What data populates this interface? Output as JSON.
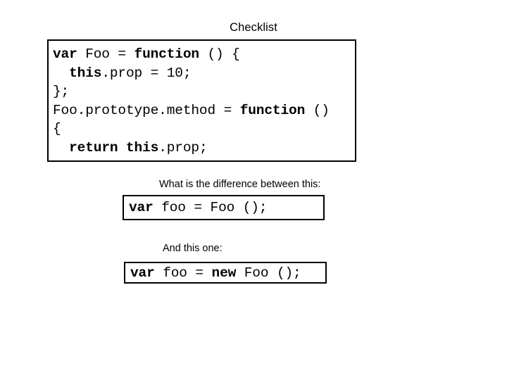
{
  "slide": {
    "title": "Checklist",
    "background_color": "#ffffff",
    "text_color": "#000000",
    "border_color": "#000000"
  },
  "main_code": {
    "lines": [
      [
        {
          "text": "var",
          "bold": true
        },
        {
          "text": " Foo = ",
          "bold": false
        },
        {
          "text": "function",
          "bold": true
        },
        {
          "text": " () {",
          "bold": false
        }
      ],
      [
        {
          "text": "  ",
          "bold": false
        },
        {
          "text": "this",
          "bold": true
        },
        {
          "text": ".prop = 10;",
          "bold": false
        }
      ],
      [
        {
          "text": "};",
          "bold": false
        }
      ],
      [
        {
          "text": "Foo.prototype.method = ",
          "bold": false
        },
        {
          "text": "function",
          "bold": true
        },
        {
          "text": " ()",
          "bold": false
        }
      ],
      [
        {
          "text": "{",
          "bold": false
        }
      ],
      [
        {
          "text": "  ",
          "bold": false
        },
        {
          "text": "return this",
          "bold": true
        },
        {
          "text": ".prop;",
          "bold": false
        }
      ],
      [
        {
          "text": "};",
          "bold": false
        }
      ]
    ],
    "plain_text": "var Foo = function () {\n  this.prop = 10;\n};\nFoo.prototype.method = function ()\n{\n  return this.prop;\n};"
  },
  "caption_1": "What is the difference between this:",
  "snippet_1": {
    "tokens": [
      {
        "text": "var",
        "bold": true
      },
      {
        "text": " foo = Foo ();",
        "bold": false
      }
    ],
    "plain_text": "var foo = Foo ();"
  },
  "caption_2": "And this one:",
  "snippet_2": {
    "tokens": [
      {
        "text": "var",
        "bold": true
      },
      {
        "text": " foo = ",
        "bold": false
      },
      {
        "text": "new",
        "bold": true
      },
      {
        "text": " Foo ();",
        "bold": false
      }
    ],
    "plain_text": "var foo = new Foo ();"
  }
}
